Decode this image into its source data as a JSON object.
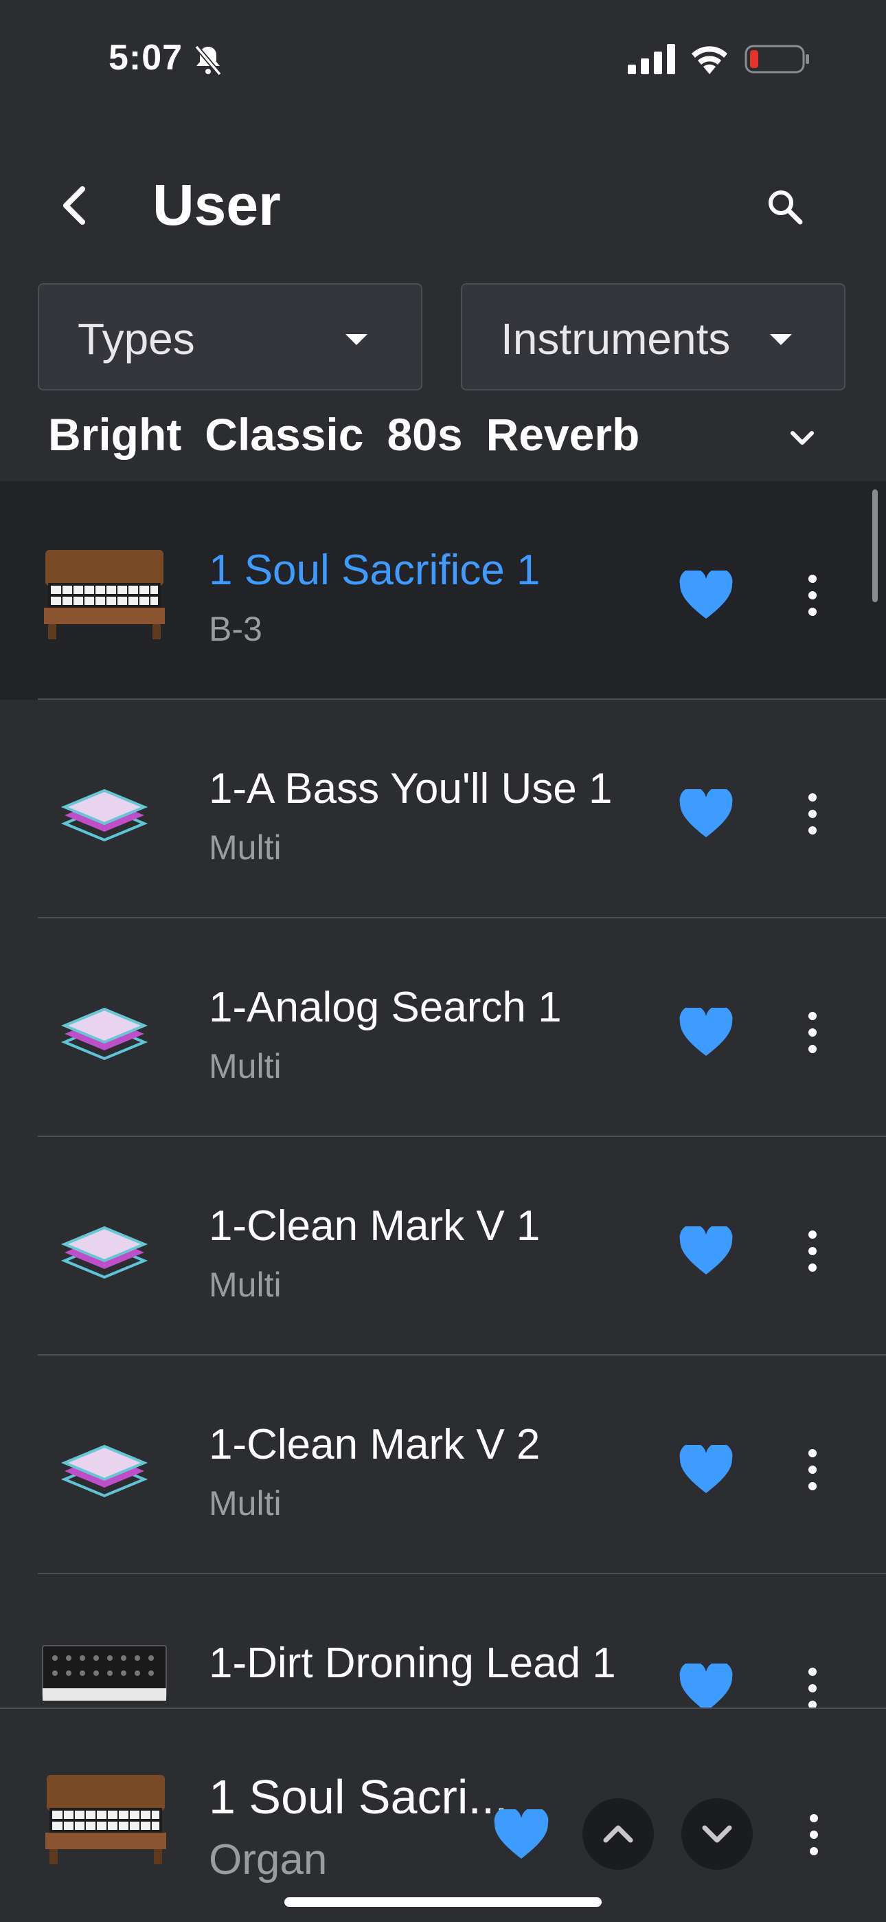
{
  "status_bar": {
    "time": "5:07"
  },
  "header": {
    "title": "User"
  },
  "filters": {
    "types_label": "Types",
    "instruments_label": "Instruments"
  },
  "tags": [
    "Bright",
    "Classic",
    "80s",
    "Reverb"
  ],
  "colors": {
    "accent": "#3e9bff",
    "background": "#2b2d31",
    "selected_row": "#222327",
    "battery_low": "#e5322b"
  },
  "presets": [
    {
      "name": "1 Soul Sacrifice 1",
      "sub": "B-3",
      "icon": "organ-thumbnail",
      "favorite": true,
      "selected": true
    },
    {
      "name": "1-A Bass You'll Use 1",
      "sub": "Multi",
      "icon": "multi-layers-icon",
      "favorite": true,
      "selected": false
    },
    {
      "name": "1-Analog Search 1",
      "sub": "Multi",
      "icon": "multi-layers-icon",
      "favorite": true,
      "selected": false
    },
    {
      "name": "1-Clean Mark V 1",
      "sub": "Multi",
      "icon": "multi-layers-icon",
      "favorite": true,
      "selected": false
    },
    {
      "name": "1-Clean Mark V 2",
      "sub": "Multi",
      "icon": "multi-layers-icon",
      "favorite": true,
      "selected": false
    },
    {
      "name": "1-Dirt Droning Lead 1",
      "sub": "",
      "icon": "synth-thumbnail",
      "favorite": true,
      "selected": false
    }
  ],
  "now_playing": {
    "name": "1 Soul Sacri...",
    "sub": "Organ",
    "favorite": true
  }
}
